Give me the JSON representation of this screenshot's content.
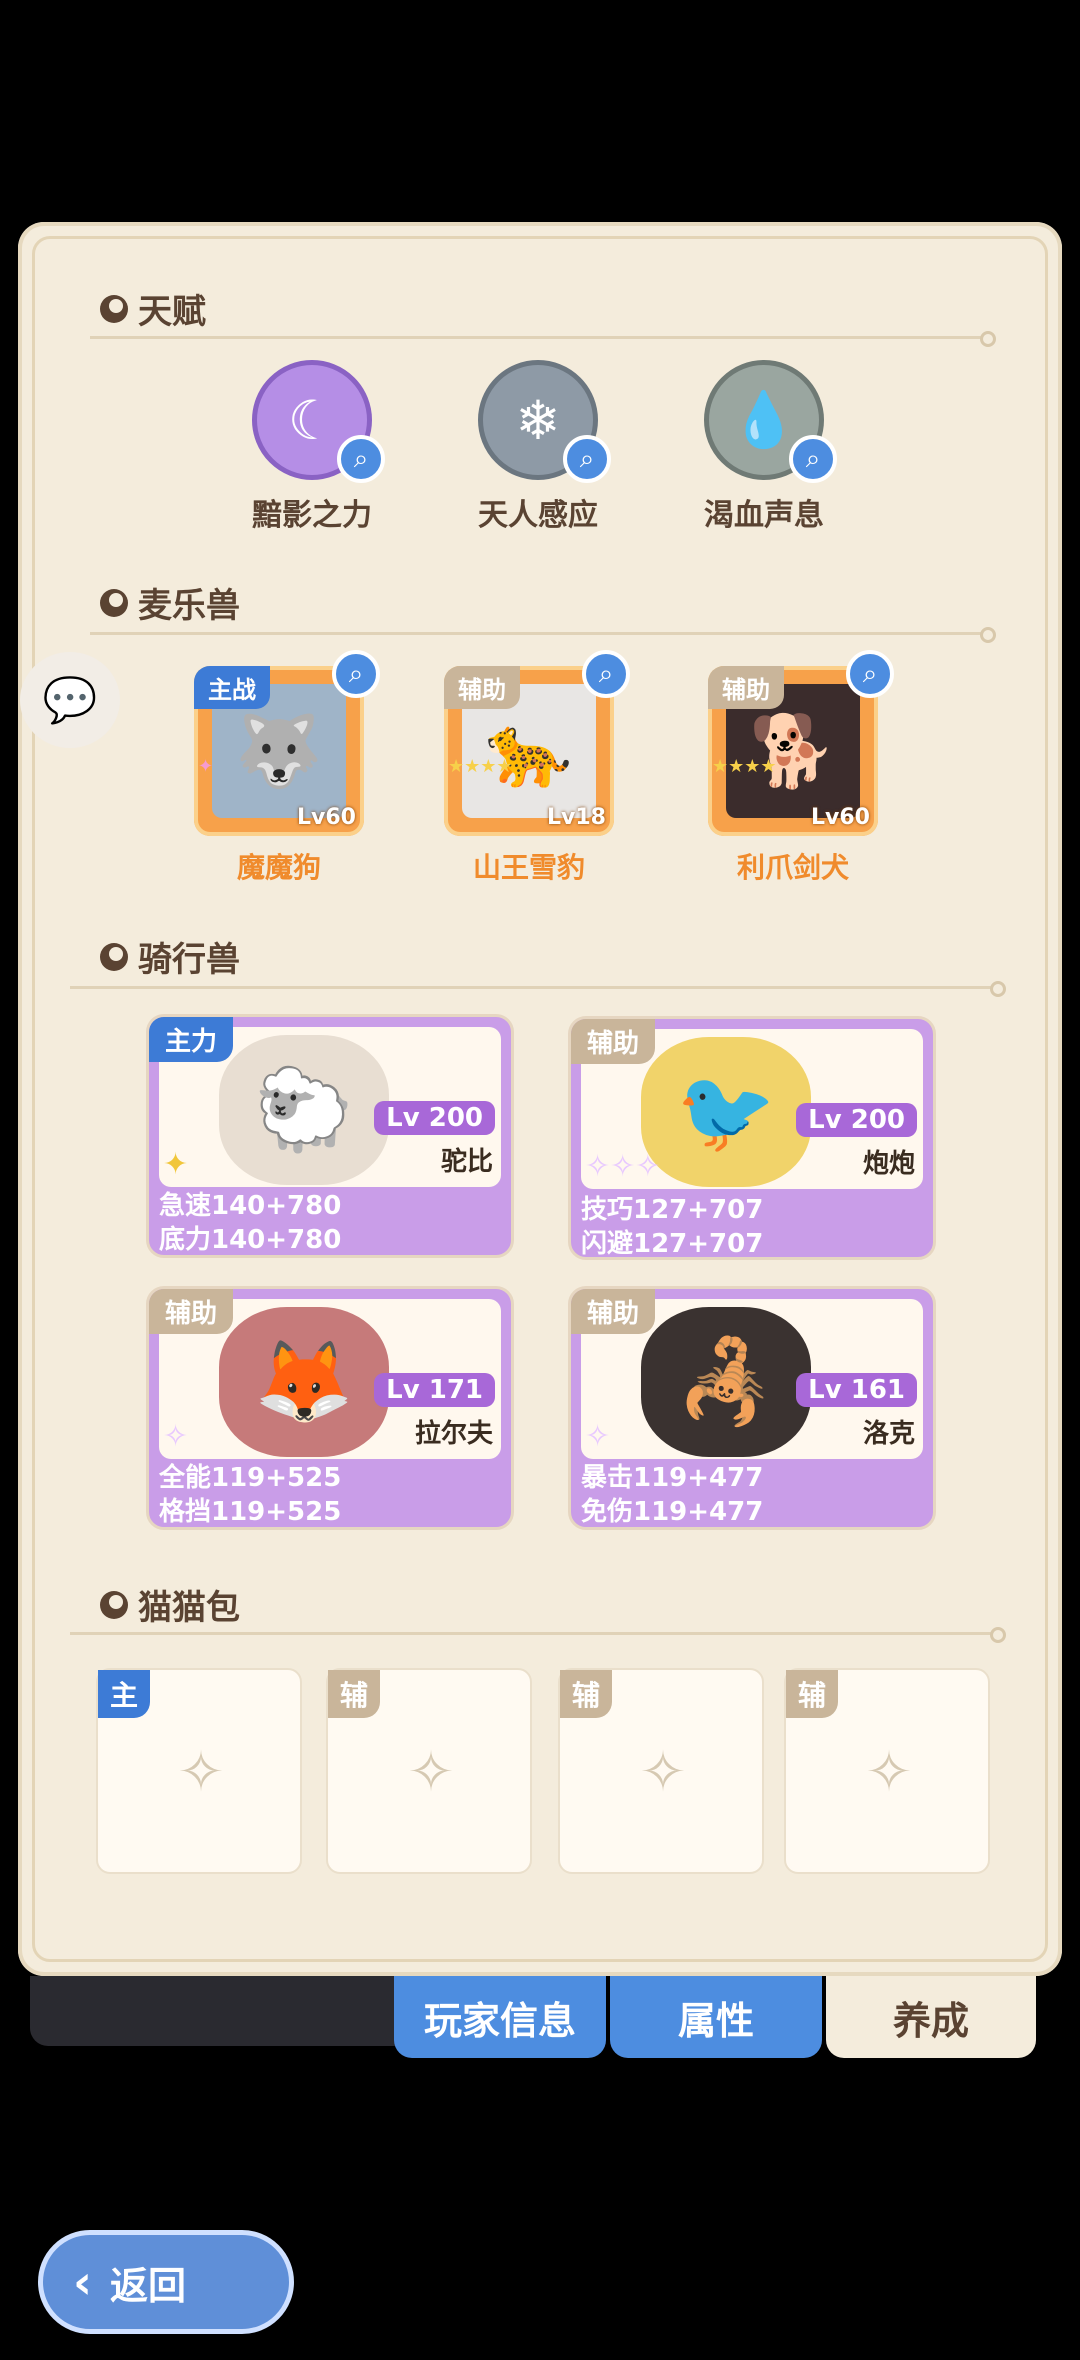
{
  "sections": {
    "talent": "天赋",
    "pets": "麦乐兽",
    "mounts": "骑行兽",
    "catbag": "猫猫包"
  },
  "talents": [
    {
      "name": "黯影之力",
      "icon": "moon-star-icon",
      "color": "#b58ee6"
    },
    {
      "name": "天人感应",
      "icon": "snowflake-icon",
      "color": "#8e9aa6"
    },
    {
      "name": "渴血声息",
      "icon": "drop-icon",
      "color": "#9aa6a0"
    }
  ],
  "pets": [
    {
      "tag": "主战",
      "level": "Lv60",
      "name": "魔魔狗",
      "stars": "✦",
      "tag_color": "#3d7bd6"
    },
    {
      "tag": "辅助",
      "level": "Lv18",
      "name": "山王雪豹",
      "stars": "★★★★",
      "tag_color": "#c9b59a"
    },
    {
      "tag": "辅助",
      "level": "Lv60",
      "name": "利爪剑犬",
      "stars": "★★★★",
      "tag_color": "#c9b59a"
    }
  ],
  "mounts": [
    {
      "tag": "主力",
      "level": "Lv 200",
      "name": "驼比",
      "stars": "✦",
      "stat1": "急速140+780",
      "stat2": "底力140+780"
    },
    {
      "tag": "辅助",
      "level": "Lv 200",
      "name": "炮炮",
      "stars": "✧✧✧",
      "stat1": "技巧127+707",
      "stat2": "闪避127+707"
    },
    {
      "tag": "辅助",
      "level": "Lv 171",
      "name": "拉尔夫",
      "stars": "✧",
      "stat1": "全能119+525",
      "stat2": "格挡119+525"
    },
    {
      "tag": "辅助",
      "level": "Lv 161",
      "name": "洛克",
      "stars": "✧",
      "stat1": "暴击119+477",
      "stat2": "免伤119+477"
    }
  ],
  "catbag": [
    {
      "tag": "主"
    },
    {
      "tag": "辅"
    },
    {
      "tag": "辅"
    },
    {
      "tag": "辅"
    }
  ],
  "tabs": {
    "player_info": "玩家信息",
    "attributes": "属性",
    "develop": "养成"
  },
  "back_label": "返回"
}
